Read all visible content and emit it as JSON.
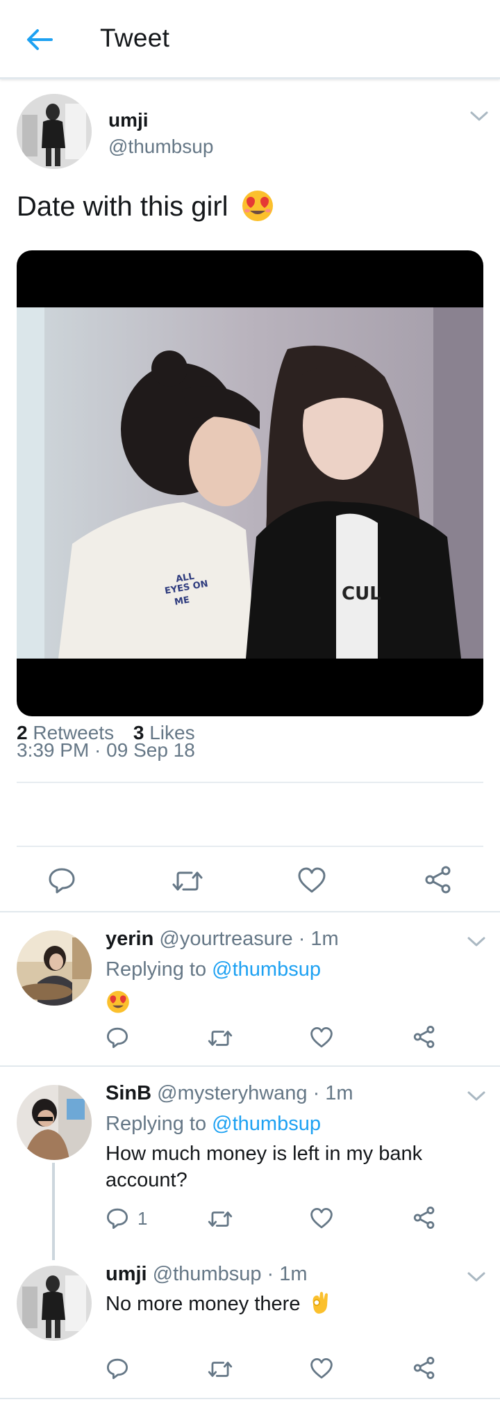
{
  "header": {
    "title": "Tweet",
    "back_icon": "arrow-left-icon",
    "accent": "#1da1f2"
  },
  "tweet": {
    "name": "umji",
    "handle": "@thumbsup",
    "text": "Date with this girl",
    "text_emoji": "smiling-face-heart-eyes-emoji",
    "media": {
      "kind": "photo",
      "shirt_text_left": "ALL\nEYES ON\nME",
      "shirt_text_right": "CUL"
    },
    "timestamp": "3:39 PM · 09 Sep 18",
    "retweets_count": "2",
    "retweets_label": "Retweets",
    "likes_count": "3",
    "likes_label": "Likes",
    "actions": [
      "reply-icon",
      "retweet-icon",
      "like-icon",
      "share-icon"
    ]
  },
  "replies": [
    {
      "name": "yerin",
      "handle": "@yourtreasure",
      "time": "· 1m",
      "replying_label": "Replying to",
      "replying_to": "@thumbsup",
      "text": "",
      "emoji": "smiling-face-heart-eyes-emoji",
      "reply_count": ""
    },
    {
      "name": "SinB",
      "handle": "@mysteryhwang",
      "time": "· 1m",
      "replying_label": "Replying to",
      "replying_to": "@thumbsup",
      "text": "How much money is left in my bank account?",
      "reply_count": "1"
    },
    {
      "name": "umji",
      "handle": "@thumbsup",
      "time": "· 1m",
      "text": "No more money there",
      "emoji": "ok-hand-emoji",
      "reply_count": ""
    }
  ]
}
